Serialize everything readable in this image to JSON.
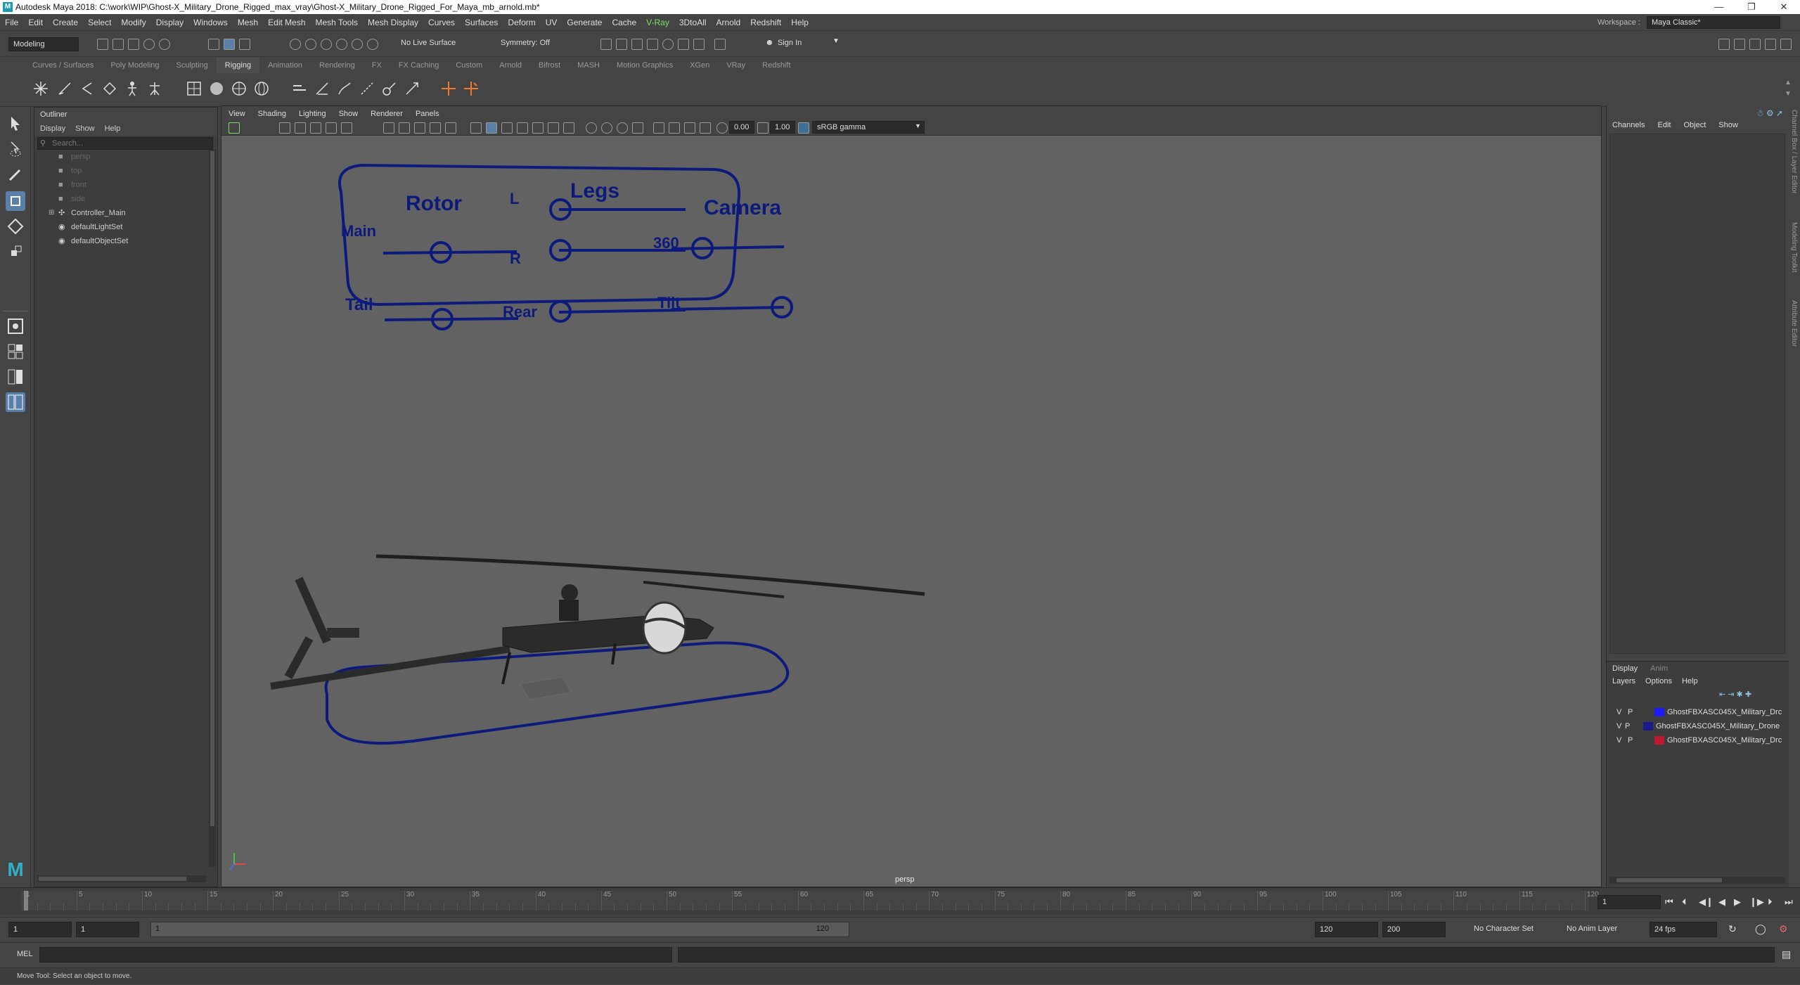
{
  "window": {
    "title": "Autodesk Maya 2018: C:\\work\\WIP\\Ghost-X_Military_Drone_Rigged_max_vray\\Ghost-X_Military_Drone_Rigged_For_Maya_mb_arnold.mb*",
    "minimize": "—",
    "restore": "❐",
    "close": "✕"
  },
  "menubar": {
    "items": [
      "File",
      "Edit",
      "Create",
      "Select",
      "Modify",
      "Display",
      "Windows",
      "Mesh",
      "Edit Mesh",
      "Mesh Tools",
      "Mesh Display",
      "Curves",
      "Surfaces",
      "Deform",
      "UV",
      "Generate",
      "Cache",
      "V-Ray",
      "3DtoAll",
      "Arnold",
      "Redshift",
      "Help"
    ],
    "workspace_label": "Workspace :",
    "workspace_value": "Maya Classic*"
  },
  "statusline": {
    "mode": "Modeling",
    "live_surface": "No Live Surface",
    "symmetry": "Symmetry: Off",
    "sign_in": "Sign In"
  },
  "shelf": {
    "tabs": [
      "Curves / Surfaces",
      "Poly Modeling",
      "Sculpting",
      "Rigging",
      "Animation",
      "Rendering",
      "FX",
      "FX Caching",
      "Custom",
      "Arnold",
      "Bifrost",
      "MASH",
      "Motion Graphics",
      "XGen",
      "VRay",
      "Redshift"
    ],
    "active_tab": "Rigging"
  },
  "outliner": {
    "title": "Outliner",
    "menus": [
      "Display",
      "Show",
      "Help"
    ],
    "search_placeholder": "Search...",
    "items": [
      {
        "label": "persp",
        "dim": true
      },
      {
        "label": "top",
        "dim": true
      },
      {
        "label": "front",
        "dim": true
      },
      {
        "label": "side",
        "dim": true
      },
      {
        "label": "Controller_Main",
        "dim": false
      },
      {
        "label": "defaultLightSet",
        "dim": false
      },
      {
        "label": "defaultObjectSet",
        "dim": false
      }
    ]
  },
  "viewport": {
    "menus": [
      "View",
      "Shading",
      "Lighting",
      "Show",
      "Renderer",
      "Panels"
    ],
    "exposure": "0.00",
    "gamma": "1.00",
    "colorspace": "sRGB gamma",
    "camera_label": "persp",
    "panel_labels": {
      "rotor": "Rotor",
      "main": "Main",
      "tail": "Tail",
      "legs": "Legs",
      "l": "L",
      "r": "R",
      "rear": "Rear",
      "camera": "Camera",
      "c360": "360",
      "tilt": "Tilt"
    }
  },
  "channelbox": {
    "menus": [
      "Channels",
      "Edit",
      "Object",
      "Show"
    ],
    "side_tabs": [
      "Channel Box / Layer Editor",
      "Modeling Toolkit",
      "Attribute Editor"
    ]
  },
  "layers": {
    "tabs": [
      "Display",
      "Anim"
    ],
    "menus": [
      "Layers",
      "Options",
      "Help"
    ],
    "rows": [
      {
        "v": "V",
        "p": "P",
        "color": "#1a1aff",
        "name": "GhostFBXASC045X_Military_Drc"
      },
      {
        "v": "V",
        "p": "P",
        "color": "#1a1a8c",
        "name": "GhostFBXASC045X_Military_Drone"
      },
      {
        "v": "V",
        "p": "P",
        "color": "#c0162e",
        "name": "GhostFBXASC045X_Military_Drc"
      }
    ]
  },
  "timeslider": {
    "ticks": [
      "1",
      "5",
      "10",
      "15",
      "20",
      "25",
      "30",
      "35",
      "40",
      "45",
      "50",
      "55",
      "60",
      "65",
      "70",
      "75",
      "80",
      "85",
      "90",
      "95",
      "100",
      "105",
      "110",
      "115",
      "120"
    ],
    "current_frame": "1"
  },
  "range": {
    "start": "1",
    "anim_start": "1",
    "slider_start": "1",
    "slider_end": "120",
    "end": "120",
    "anim_end": "200",
    "character_set": "No Character Set",
    "anim_layer": "No Anim Layer",
    "fps": "24 fps"
  },
  "cmdline": {
    "label": "MEL"
  },
  "helpline": {
    "text": "Move Tool: Select an object to move."
  }
}
